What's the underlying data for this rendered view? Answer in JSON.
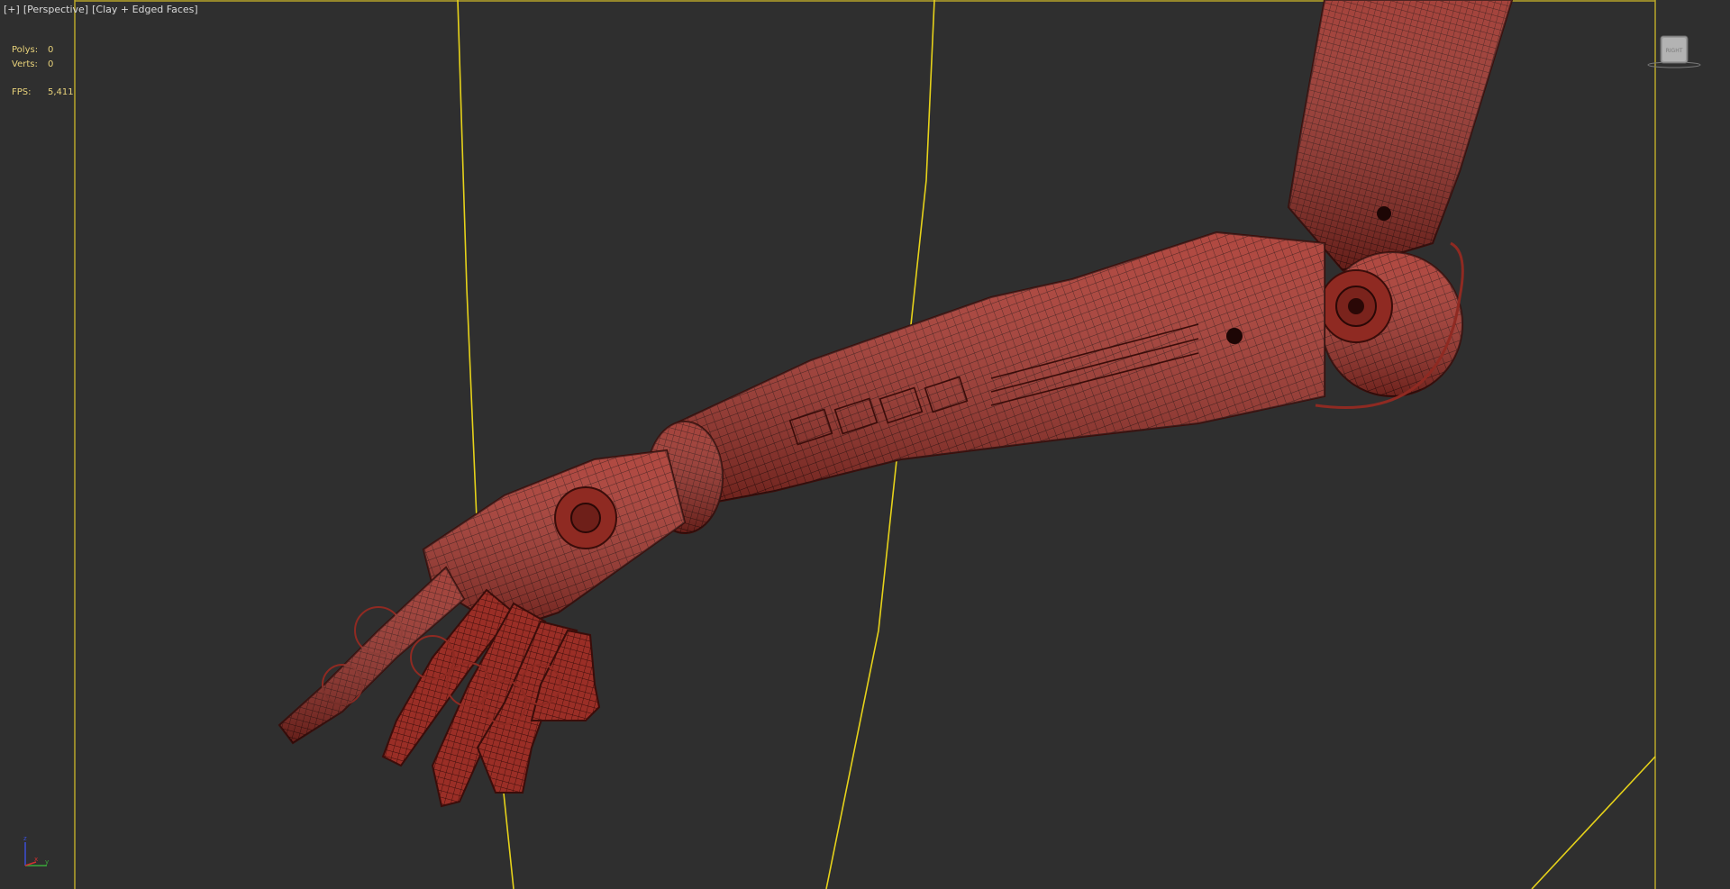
{
  "viewport": {
    "labels": [
      "[+]",
      "[Perspective]",
      "[Clay + Edged Faces]"
    ]
  },
  "stats": {
    "polys_label": "Polys:",
    "polys_value": "0",
    "verts_label": "Verts:",
    "verts_value": "0",
    "fps_label": "FPS:",
    "fps_value": "5,411"
  },
  "viewcube": {
    "face_label": "RIGHT"
  },
  "axis_tripod": {
    "z_label": "z",
    "x_label": "x",
    "y_label": "y"
  },
  "colors": {
    "background": "#2f2f2f",
    "selection_frame": "#b8a62a",
    "grid_line": "#e6d21a",
    "model": "#a8342b",
    "wire": "#3a0d0a",
    "stats_text": "#e8d27a"
  },
  "icons": [
    "viewcube-icon",
    "axis-tripod-icon"
  ]
}
